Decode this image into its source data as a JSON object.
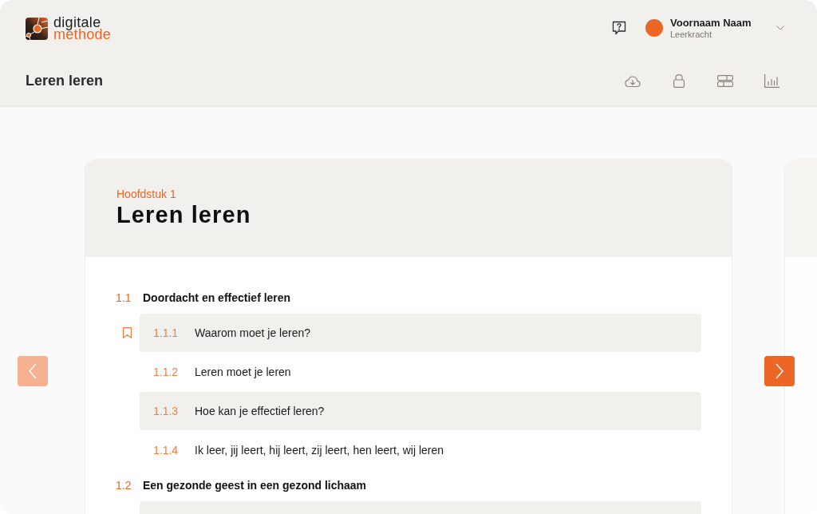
{
  "logo": {
    "top": "digitale",
    "bottom": "methode"
  },
  "user": {
    "name": "Voornaam Naam",
    "role": "Leerkracht"
  },
  "page_title": "Leren leren",
  "chapter": {
    "label": "Hoofdstuk 1",
    "title": "Leren leren",
    "sections": [
      {
        "number": "1.1",
        "title": "Doordacht en effectief leren",
        "items": [
          {
            "number": "1.1.1",
            "title": "Waarom moet je leren?",
            "bookmarked": true
          },
          {
            "number": "1.1.2",
            "title": "Leren moet je leren",
            "bookmarked": false
          },
          {
            "number": "1.1.3",
            "title": "Hoe kan je effectief leren?",
            "bookmarked": false
          },
          {
            "number": "1.1.4",
            "title": "Ik leer, jij leert, hij leert, zij leert, hen leert, wij leren",
            "bookmarked": false
          }
        ]
      },
      {
        "number": "1.2",
        "title": "Een gezonde geest in een gezond lichaam"
      }
    ]
  },
  "navigation": {
    "previous": {
      "disabled": true
    },
    "next": {
      "disabled": false
    }
  }
}
